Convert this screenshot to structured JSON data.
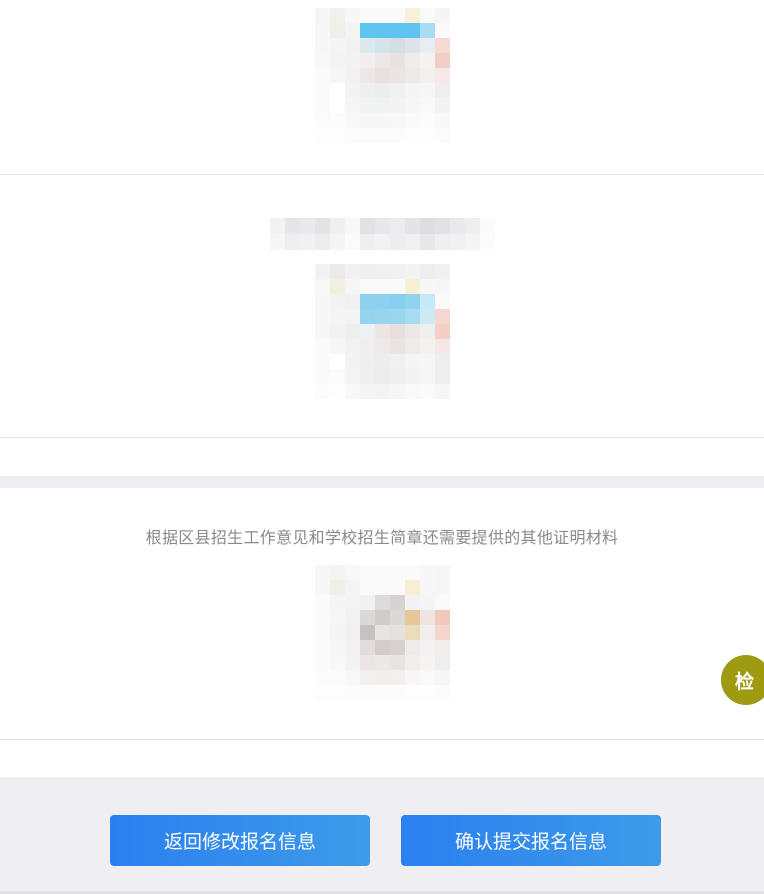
{
  "toolbar": {
    "icons": [
      "back-icon",
      "link-icon",
      "circle-icon",
      "globe-icon",
      "share-icon",
      "cube-icon",
      "face-icon"
    ]
  },
  "sections": {
    "other_materials_caption": "根据区县招生工作意见和学校招生简章还需要提供的其他证明材料"
  },
  "footer": {
    "back_button_label": "返回修改报名信息",
    "confirm_button_label": "确认提交报名信息"
  },
  "floating": {
    "check_label": "检"
  },
  "colors": {
    "button_gradient_start": "#2b7ff0",
    "button_gradient_end": "#3d9be8",
    "fab": "#9e9b12",
    "band": "#eeeef2"
  }
}
